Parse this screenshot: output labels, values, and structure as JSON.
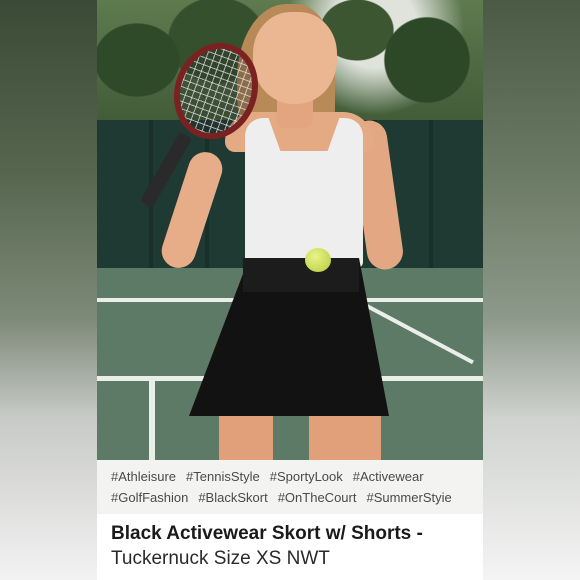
{
  "listing": {
    "tags": [
      "#Athleisure",
      "#TennisStyle",
      "#SportyLook",
      "#Activewear",
      "#GolfFashion",
      "#BlackSkort",
      "#OnTheCourt",
      "#SummerStyie"
    ],
    "title_line1": "Black Activewear Skort w/ Shorts -",
    "title_line2": "Tuckernuck Size XS NWT"
  }
}
